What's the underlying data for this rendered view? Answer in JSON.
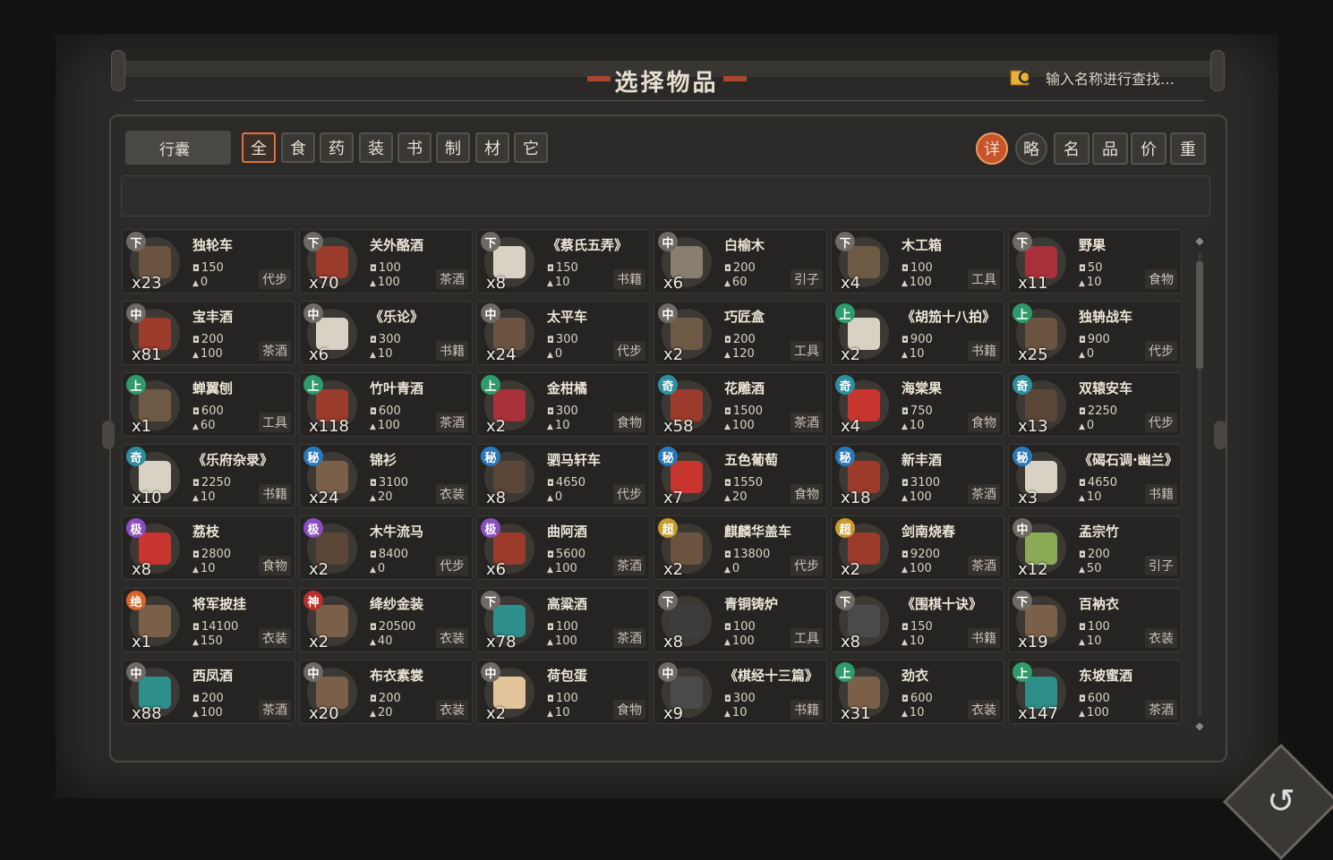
{
  "header": {
    "title": "选择物品",
    "search_placeholder": "输入名称进行查找…"
  },
  "bag_tab": "行囊",
  "categories": [
    "全",
    "食",
    "药",
    "装",
    "书",
    "制",
    "材",
    "它"
  ],
  "sort_buttons": [
    "详",
    "略",
    "名",
    "品",
    "价",
    "重"
  ],
  "colors": {
    "accent": "#e0713b",
    "grade_下": "#6e6a64",
    "grade_中": "#6e6a64",
    "grade_上": "#2f9a6a",
    "grade_奇": "#2f8fa0",
    "grade_秘": "#2b78b8",
    "grade_极": "#8a4fc0",
    "grade_超": "#c99a2e",
    "grade_绝": "#d4662a",
    "grade_神": "#b8302b"
  },
  "items": [
    {
      "grade": "下",
      "name": "独轮车",
      "price": "150",
      "weight": "0",
      "type": "代步",
      "count": "x23",
      "icon": "wheel-icon"
    },
    {
      "grade": "下",
      "name": "关外酪酒",
      "price": "100",
      "weight": "100",
      "type": "茶酒",
      "count": "x70",
      "icon": "wine-jar-icon"
    },
    {
      "grade": "下",
      "name": "《蔡氏五弄》",
      "price": "150",
      "weight": "10",
      "type": "书籍",
      "count": "x8",
      "icon": "scroll-book-icon"
    },
    {
      "grade": "中",
      "name": "白榆木",
      "price": "200",
      "weight": "60",
      "type": "引子",
      "count": "x6",
      "icon": "wood-icon"
    },
    {
      "grade": "下",
      "name": "木工箱",
      "price": "100",
      "weight": "100",
      "type": "工具",
      "count": "x4",
      "icon": "toolbox-icon"
    },
    {
      "grade": "下",
      "name": "野果",
      "price": "50",
      "weight": "10",
      "type": "食物",
      "count": "x11",
      "icon": "berries-icon"
    },
    {
      "grade": "中",
      "name": "宝丰酒",
      "price": "200",
      "weight": "100",
      "type": "茶酒",
      "count": "x81",
      "icon": "wine-jar-icon"
    },
    {
      "grade": "中",
      "name": "《乐论》",
      "price": "300",
      "weight": "10",
      "type": "书籍",
      "count": "x6",
      "icon": "scroll-book-icon"
    },
    {
      "grade": "中",
      "name": "太平车",
      "price": "300",
      "weight": "0",
      "type": "代步",
      "count": "x24",
      "icon": "wheel-icon"
    },
    {
      "grade": "中",
      "name": "巧匠盒",
      "price": "200",
      "weight": "120",
      "type": "工具",
      "count": "x2",
      "icon": "toolbox-icon"
    },
    {
      "grade": "上",
      "name": "《胡笳十八拍》",
      "price": "900",
      "weight": "10",
      "type": "书籍",
      "count": "x2",
      "icon": "scroll-book-icon"
    },
    {
      "grade": "上",
      "name": "独辀战车",
      "price": "900",
      "weight": "0",
      "type": "代步",
      "count": "x25",
      "icon": "wheel-icon"
    },
    {
      "grade": "上",
      "name": "蝉翼刨",
      "price": "600",
      "weight": "60",
      "type": "工具",
      "count": "x1",
      "icon": "toolbox-icon"
    },
    {
      "grade": "上",
      "name": "竹叶青酒",
      "price": "600",
      "weight": "100",
      "type": "茶酒",
      "count": "x118",
      "icon": "wine-jar-icon"
    },
    {
      "grade": "上",
      "name": "金柑橘",
      "price": "300",
      "weight": "10",
      "type": "食物",
      "count": "x2",
      "icon": "berries-icon"
    },
    {
      "grade": "奇",
      "name": "花雕酒",
      "price": "1500",
      "weight": "100",
      "type": "茶酒",
      "count": "x58",
      "icon": "wine-jar-icon"
    },
    {
      "grade": "奇",
      "name": "海棠果",
      "price": "750",
      "weight": "10",
      "type": "食物",
      "count": "x4",
      "icon": "cherry-icon"
    },
    {
      "grade": "奇",
      "name": "双辕安车",
      "price": "2250",
      "weight": "0",
      "type": "代步",
      "count": "x13",
      "icon": "cart-icon"
    },
    {
      "grade": "奇",
      "name": "《乐府杂录》",
      "price": "2250",
      "weight": "10",
      "type": "书籍",
      "count": "x10",
      "icon": "scroll-book-icon"
    },
    {
      "grade": "秘",
      "name": "锦衫",
      "price": "3100",
      "weight": "20",
      "type": "衣装",
      "count": "x24",
      "icon": "chest-icon"
    },
    {
      "grade": "秘",
      "name": "驷马轩车",
      "price": "4650",
      "weight": "0",
      "type": "代步",
      "count": "x8",
      "icon": "cart-icon"
    },
    {
      "grade": "秘",
      "name": "五色葡萄",
      "price": "1550",
      "weight": "20",
      "type": "食物",
      "count": "x7",
      "icon": "cherry-icon"
    },
    {
      "grade": "秘",
      "name": "新丰酒",
      "price": "3100",
      "weight": "100",
      "type": "茶酒",
      "count": "x18",
      "icon": "wine-jar-icon"
    },
    {
      "grade": "秘",
      "name": "《碣石调·幽兰》",
      "price": "4650",
      "weight": "10",
      "type": "书籍",
      "count": "x3",
      "icon": "scroll-book-icon"
    },
    {
      "grade": "极",
      "name": "荔枝",
      "price": "2800",
      "weight": "10",
      "type": "食物",
      "count": "x8",
      "icon": "cherry-icon"
    },
    {
      "grade": "极",
      "name": "木牛流马",
      "price": "8400",
      "weight": "0",
      "type": "代步",
      "count": "x2",
      "icon": "cart-icon"
    },
    {
      "grade": "极",
      "name": "曲阿酒",
      "price": "5600",
      "weight": "100",
      "type": "茶酒",
      "count": "x6",
      "icon": "wine-jar-icon"
    },
    {
      "grade": "超",
      "name": "麒麟华盖车",
      "price": "13800",
      "weight": "0",
      "type": "代步",
      "count": "x2",
      "icon": "wheel-icon"
    },
    {
      "grade": "超",
      "name": "剑南烧春",
      "price": "9200",
      "weight": "100",
      "type": "茶酒",
      "count": "x2",
      "icon": "wine-jar-icon"
    },
    {
      "grade": "中",
      "name": "孟宗竹",
      "price": "200",
      "weight": "50",
      "type": "引子",
      "count": "x12",
      "icon": "bamboo-icon"
    },
    {
      "grade": "绝",
      "name": "将军披挂",
      "price": "14100",
      "weight": "150",
      "type": "衣装",
      "count": "x1",
      "icon": "chest-icon"
    },
    {
      "grade": "神",
      "name": "绛纱金装",
      "price": "20500",
      "weight": "40",
      "type": "衣装",
      "count": "x2",
      "icon": "chest-icon"
    },
    {
      "grade": "下",
      "name": "高粱酒",
      "price": "100",
      "weight": "100",
      "type": "茶酒",
      "count": "x78",
      "icon": "wine-bottle-icon"
    },
    {
      "grade": "下",
      "name": "青铜铸炉",
      "price": "100",
      "weight": "100",
      "type": "工具",
      "count": "x8",
      "icon": "furnace-icon"
    },
    {
      "grade": "下",
      "name": "《围棋十诀》",
      "price": "150",
      "weight": "10",
      "type": "书籍",
      "count": "x8",
      "icon": "book-icon"
    },
    {
      "grade": "下",
      "name": "百衲衣",
      "price": "100",
      "weight": "10",
      "type": "衣装",
      "count": "x19",
      "icon": "chest-icon"
    },
    {
      "grade": "中",
      "name": "西凤酒",
      "price": "200",
      "weight": "100",
      "type": "茶酒",
      "count": "x88",
      "icon": "wine-bottle-icon"
    },
    {
      "grade": "中",
      "name": "布衣素裳",
      "price": "200",
      "weight": "20",
      "type": "衣装",
      "count": "x20",
      "icon": "chest-icon"
    },
    {
      "grade": "中",
      "name": "荷包蛋",
      "price": "100",
      "weight": "10",
      "type": "食物",
      "count": "x2",
      "icon": "egg-icon"
    },
    {
      "grade": "中",
      "name": "《棋经十三篇》",
      "price": "300",
      "weight": "10",
      "type": "书籍",
      "count": "x9",
      "icon": "book-icon"
    },
    {
      "grade": "上",
      "name": "劲衣",
      "price": "600",
      "weight": "10",
      "type": "衣装",
      "count": "x31",
      "icon": "chest-icon"
    },
    {
      "grade": "上",
      "name": "东坡蜜酒",
      "price": "600",
      "weight": "100",
      "type": "茶酒",
      "count": "x147",
      "icon": "wine-bottle-icon"
    }
  ]
}
